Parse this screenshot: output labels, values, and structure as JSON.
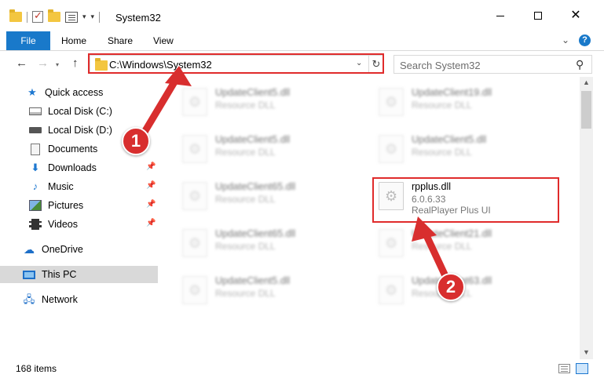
{
  "window": {
    "title": "System32"
  },
  "ribbon": {
    "tabs": [
      {
        "label": "File"
      },
      {
        "label": "Home"
      },
      {
        "label": "Share"
      },
      {
        "label": "View"
      }
    ],
    "help_label": "?"
  },
  "address_bar": {
    "path": "C:\\Windows\\System32"
  },
  "search": {
    "placeholder": "Search System32"
  },
  "sidebar": {
    "items": [
      {
        "label": "Quick access",
        "icon": "star-icon"
      },
      {
        "label": "Local Disk (C:)",
        "icon": "drive-icon"
      },
      {
        "label": "Local Disk (D:)",
        "icon": "drive-icon"
      },
      {
        "label": "Documents",
        "icon": "documents-icon"
      },
      {
        "label": "Downloads",
        "icon": "download-icon"
      },
      {
        "label": "Music",
        "icon": "music-icon"
      },
      {
        "label": "Pictures",
        "icon": "pictures-icon"
      },
      {
        "label": "Videos",
        "icon": "videos-icon"
      },
      {
        "label": "OneDrive",
        "icon": "cloud-icon"
      },
      {
        "label": "This PC",
        "icon": "computer-icon"
      },
      {
        "label": "Network",
        "icon": "network-icon"
      }
    ]
  },
  "files": [
    {
      "name": "UpdateClient5.dll",
      "type": "Resource DLL"
    },
    {
      "name": "UpdateClient19.dll",
      "type": "Resource DLL"
    },
    {
      "name": "UpdateClient5.dll",
      "type": "Resource DLL"
    },
    {
      "name": "UpdateClient5.dll",
      "type": "Resource DLL"
    },
    {
      "name": "UpdateClient65.dll",
      "type": "Resource DLL"
    },
    {
      "name": "rpplus.dll",
      "version": "6.0.6.33",
      "description": "RealPlayer Plus UI"
    },
    {
      "name": "UpdateClient65.dll",
      "type": "Resource DLL"
    },
    {
      "name": "UpdateClient21.dll",
      "type": "Resource DLL"
    },
    {
      "name": "UpdateClient5.dll",
      "type": "Resource DLL"
    },
    {
      "name": "UpdateClient63.dll",
      "type": "Resource DLL"
    }
  ],
  "annotations": {
    "step1": "1",
    "step2": "2",
    "highlight_color": "#e02b2b"
  },
  "status": {
    "item_count": "168 items"
  },
  "colors": {
    "accent": "#1979ca",
    "selected_bg": "#d9d9d9"
  }
}
